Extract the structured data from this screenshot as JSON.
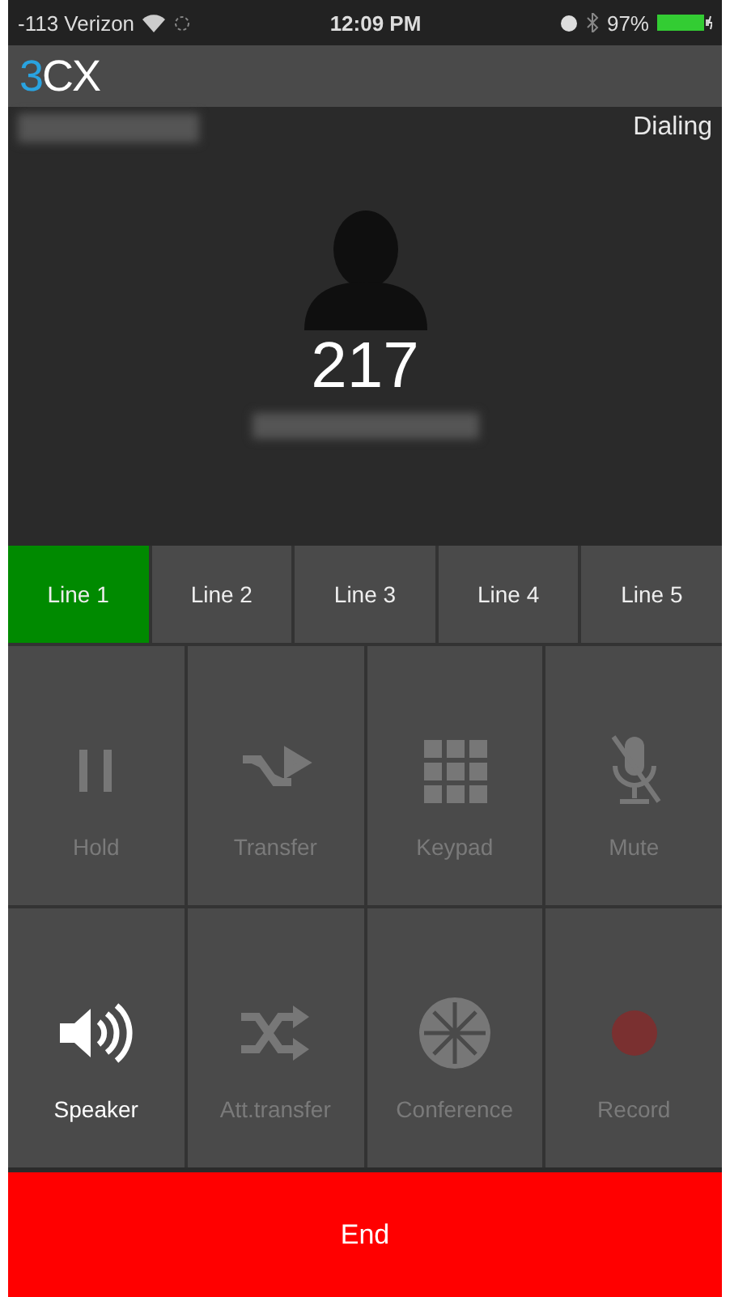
{
  "status_bar": {
    "carrier": "-113 Verizon",
    "time": "12:09 PM",
    "battery": "97%"
  },
  "app_bar": {
    "logo_accent": "3",
    "logo_rest": "CX"
  },
  "call": {
    "status": "Dialing",
    "number": "217"
  },
  "lines": [
    {
      "label": "Line 1",
      "selected": true
    },
    {
      "label": "Line 2",
      "selected": false
    },
    {
      "label": "Line 3",
      "selected": false
    },
    {
      "label": "Line 4",
      "selected": false
    },
    {
      "label": "Line 5",
      "selected": false
    }
  ],
  "actions": [
    {
      "kind": "hold",
      "label": "Hold",
      "disabled": true
    },
    {
      "kind": "transfer",
      "label": "Transfer",
      "disabled": true
    },
    {
      "kind": "keypad",
      "label": "Keypad",
      "disabled": true
    },
    {
      "kind": "mute",
      "label": "Mute",
      "disabled": true
    },
    {
      "kind": "speaker",
      "label": "Speaker",
      "disabled": false
    },
    {
      "kind": "att-transfer",
      "label": "Att.transfer",
      "disabled": true
    },
    {
      "kind": "conference",
      "label": "Conference",
      "disabled": true
    },
    {
      "kind": "record",
      "label": "Record",
      "disabled": true
    }
  ],
  "end_button": "End"
}
